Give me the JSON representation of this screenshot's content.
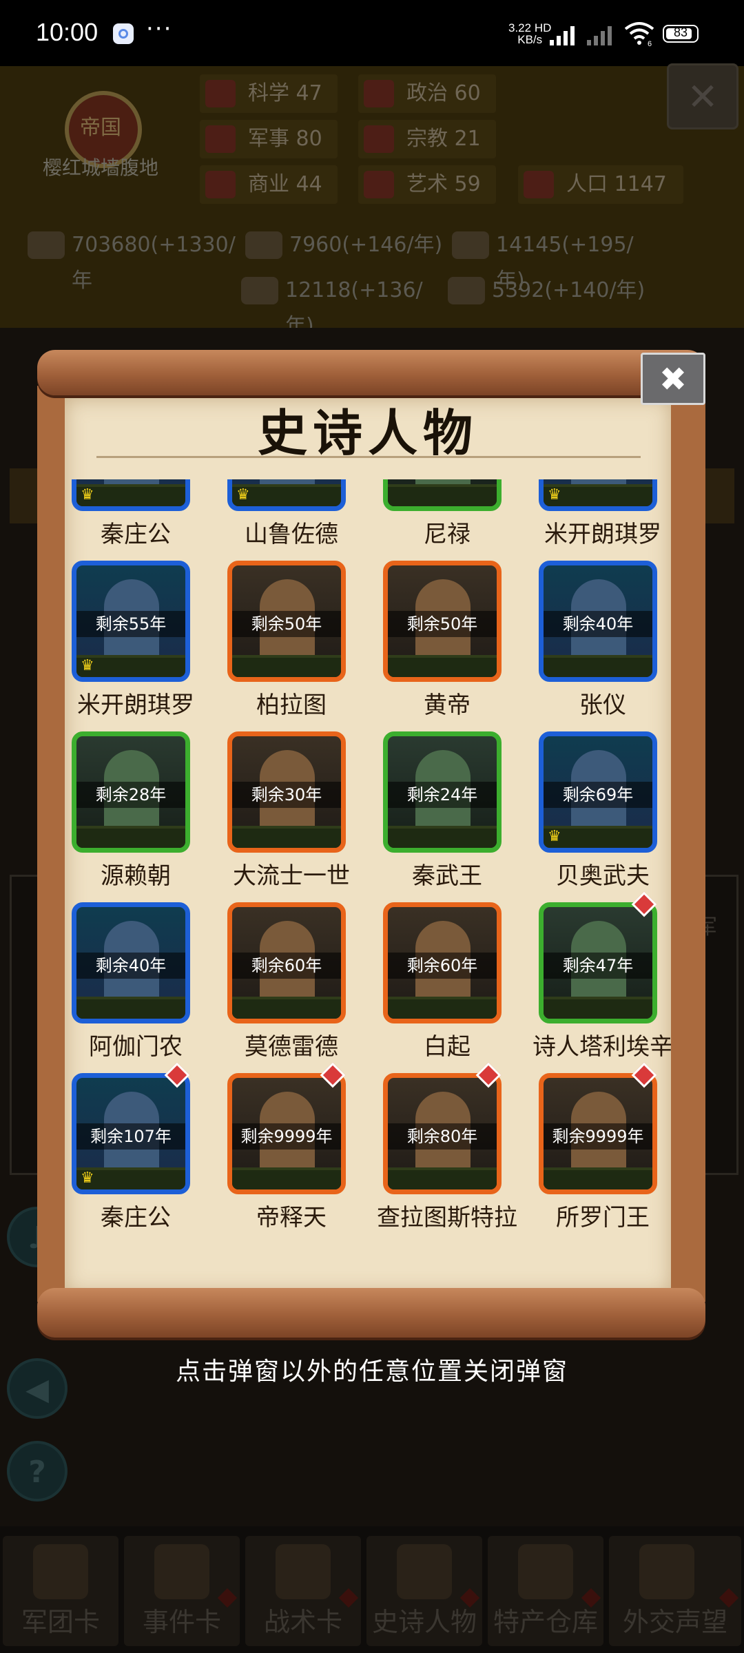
{
  "status_bar": {
    "time": "10:00",
    "more": "···",
    "net_speed": "3.22",
    "net_unit": "KB/s",
    "net_hd": "HD",
    "wifi_gen": "6",
    "battery": "83"
  },
  "background": {
    "empire_emblem": "帝国",
    "empire_name": "樱红城墙腹地",
    "stats": [
      {
        "label": "科学",
        "value": "47"
      },
      {
        "label": "政治",
        "value": "60"
      },
      {
        "label": "军事",
        "value": "80"
      },
      {
        "label": "宗教",
        "value": "21"
      },
      {
        "label": "商业",
        "value": "44"
      },
      {
        "label": "艺术",
        "value": "59"
      },
      {
        "label": "人口",
        "value": "1147"
      }
    ],
    "resources": [
      "703680(+1330/年",
      "7960(+146/年)",
      "14145(+195/年)",
      "12118(+136/年)",
      "5392(+140/年)"
    ],
    "side_right_fragment": "军",
    "bottom_tabs": [
      "军团卡",
      "事件卡",
      "战术卡",
      "史诗人物",
      "特产仓库",
      "外交声望"
    ]
  },
  "modal": {
    "title": "史诗人物",
    "characters": [
      {
        "name": "秦庄公",
        "remaining": "",
        "rarity": "blue",
        "crown": true,
        "gem": false
      },
      {
        "name": "山鲁佐德",
        "remaining": "",
        "rarity": "blue",
        "crown": true,
        "gem": false
      },
      {
        "name": "尼禄",
        "remaining": "",
        "rarity": "green",
        "crown": false,
        "gem": false
      },
      {
        "name": "米开朗琪罗",
        "remaining": "",
        "rarity": "blue",
        "crown": true,
        "gem": false
      },
      {
        "name": "米开朗琪罗",
        "remaining": "剩余55年",
        "rarity": "blue",
        "crown": true,
        "gem": false
      },
      {
        "name": "柏拉图",
        "remaining": "剩余50年",
        "rarity": "orange",
        "crown": false,
        "gem": false
      },
      {
        "name": "黄帝",
        "remaining": "剩余50年",
        "rarity": "orange",
        "crown": false,
        "gem": false
      },
      {
        "name": "张仪",
        "remaining": "剩余40年",
        "rarity": "blue",
        "crown": false,
        "gem": false
      },
      {
        "name": "源赖朝",
        "remaining": "剩余28年",
        "rarity": "green",
        "crown": false,
        "gem": false
      },
      {
        "name": "大流士一世",
        "remaining": "剩余30年",
        "rarity": "orange",
        "crown": false,
        "gem": false
      },
      {
        "name": "秦武王",
        "remaining": "剩余24年",
        "rarity": "green",
        "crown": false,
        "gem": false
      },
      {
        "name": "贝奥武夫",
        "remaining": "剩余69年",
        "rarity": "blue",
        "crown": true,
        "gem": false
      },
      {
        "name": "阿伽门农",
        "remaining": "剩余40年",
        "rarity": "blue",
        "crown": false,
        "gem": false
      },
      {
        "name": "莫德雷德",
        "remaining": "剩余60年",
        "rarity": "orange",
        "crown": false,
        "gem": false
      },
      {
        "name": "白起",
        "remaining": "剩余60年",
        "rarity": "orange",
        "crown": false,
        "gem": false
      },
      {
        "name": "诗人塔利埃辛",
        "remaining": "剩余47年",
        "rarity": "green",
        "crown": false,
        "gem": true
      },
      {
        "name": "秦庄公",
        "remaining": "剩余107年",
        "rarity": "blue",
        "crown": true,
        "gem": true
      },
      {
        "name": "帝释天",
        "remaining": "剩余9999年",
        "rarity": "orange",
        "crown": false,
        "gem": true
      },
      {
        "name": "查拉图斯特拉",
        "remaining": "剩余80年",
        "rarity": "orange",
        "crown": false,
        "gem": true
      },
      {
        "name": "所罗门王",
        "remaining": "剩余9999年",
        "rarity": "orange",
        "crown": false,
        "gem": true
      }
    ],
    "dismiss_hint": "点击弹窗以外的任意位置关闭弹窗"
  },
  "colors": {
    "rarity_blue": "#1d5fd7",
    "rarity_orange": "#e8641a",
    "rarity_green": "#3cae2e",
    "gem_red": "#d93a3a",
    "crown_gold": "#f4d31a",
    "parchment": "#efe1c4",
    "scroll_wood": "#aa6a3e"
  },
  "icons": {
    "crown": "♛",
    "close": "✖"
  }
}
